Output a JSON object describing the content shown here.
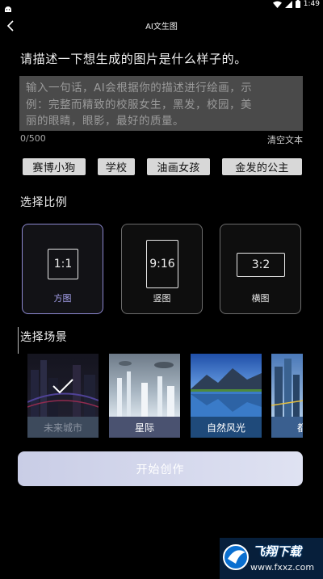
{
  "status_bar": {
    "time": "1:49",
    "icons": [
      "android-icon",
      "wifi-icon",
      "cellular-icon",
      "battery-icon"
    ]
  },
  "app_bar": {
    "title": "AI文生图",
    "back_icon": "back-arrow-icon"
  },
  "prompt": {
    "heading": "请描述一下想生成的图片是什么样子的。"
  },
  "input": {
    "placeholder_lines": [
      "输入一句话，AI会根据你的描述进行绘画，示",
      "例：完整而精致的校服女生，黑发，校园，美",
      "丽的眼睛，眼影，最好的质量。"
    ],
    "value": "",
    "counter": "0/500",
    "clear_label": "清空文本"
  },
  "suggestions": [
    "赛博小狗",
    "学校",
    "油画女孩",
    "金发的公主"
  ],
  "ratio_section": {
    "title": "选择比例",
    "options": [
      {
        "ratio": "1:1",
        "label": "方图",
        "selected": true
      },
      {
        "ratio": "9:16",
        "label": "竖图",
        "selected": false
      },
      {
        "ratio": "3:2",
        "label": "横图",
        "selected": false
      }
    ]
  },
  "scene_section": {
    "title": "选择场景",
    "scenes": [
      {
        "label": "未来城市",
        "selected": true
      },
      {
        "label": "星际",
        "selected": false
      },
      {
        "label": "自然风光",
        "selected": false
      },
      {
        "label": "都市",
        "selected": false
      }
    ]
  },
  "start_button": {
    "label": "开始创作"
  },
  "watermark": {
    "text": "飞翔下载",
    "url": "www.fxxz.com"
  },
  "colors": {
    "accent": "#8c88d0",
    "button_bg": "#d2d5ea",
    "background": "#000000"
  }
}
